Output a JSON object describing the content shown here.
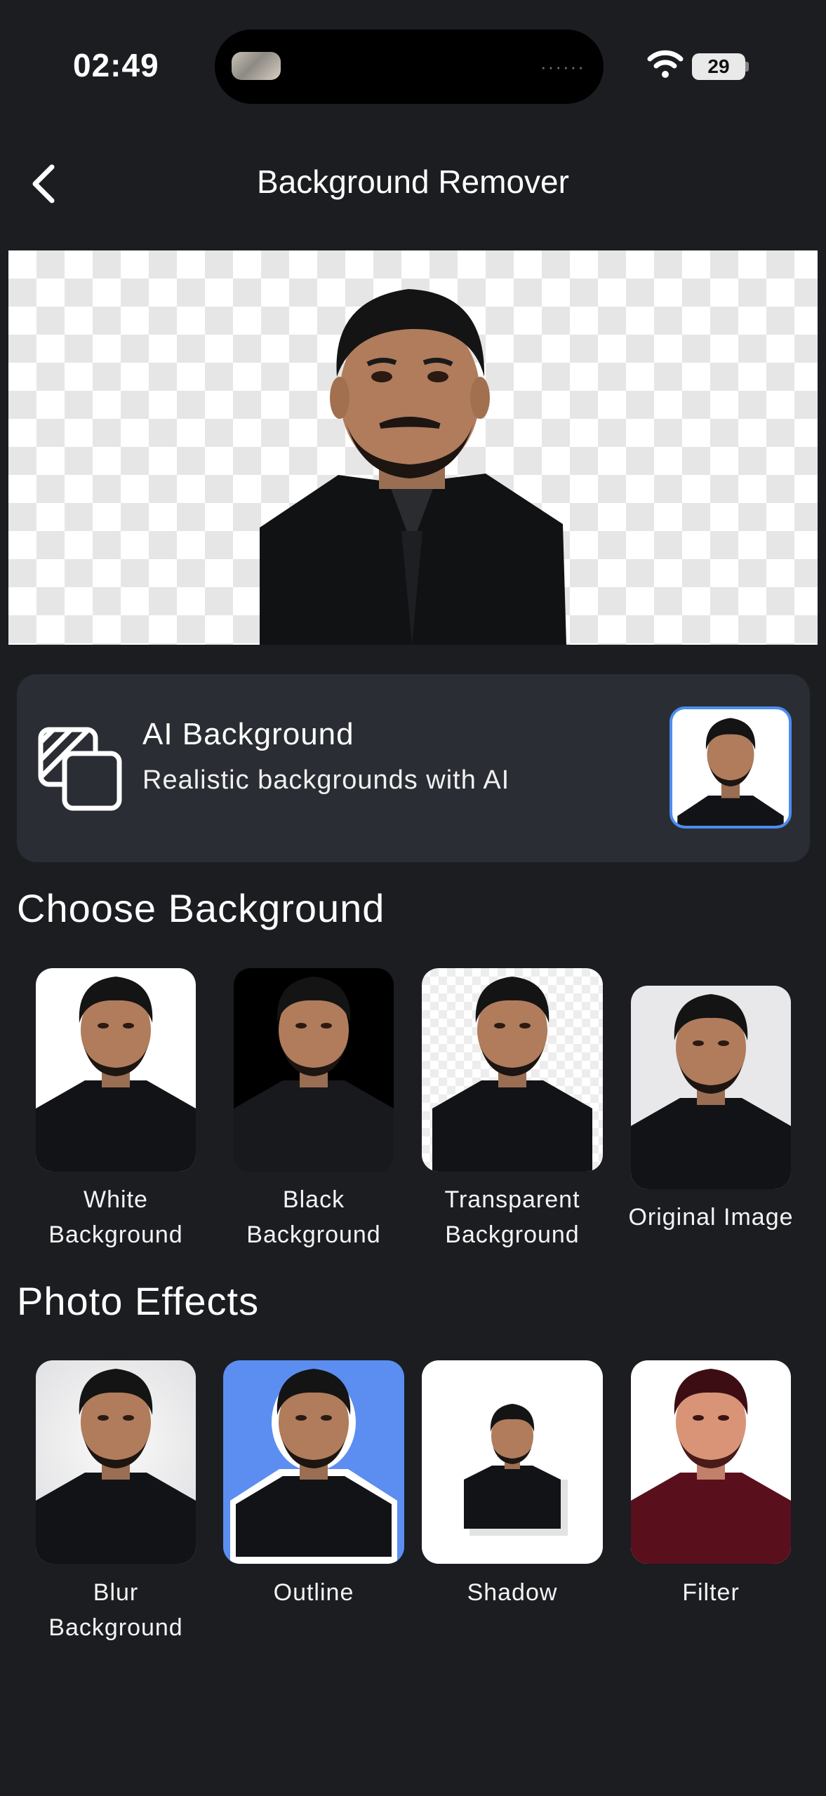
{
  "status_bar": {
    "time": "02:49",
    "battery": "29"
  },
  "header": {
    "title": "Background Remover"
  },
  "ai_card": {
    "title": "AI Background",
    "subtitle": "Realistic backgrounds with AI"
  },
  "choose_background": {
    "heading": "Choose Background",
    "options": [
      {
        "line1": "White",
        "line2": "Background"
      },
      {
        "line1": "Black",
        "line2": "Background"
      },
      {
        "line1": "Transparent",
        "line2": "Background"
      },
      {
        "line1": "Original Image",
        "line2": ""
      }
    ]
  },
  "photo_effects": {
    "heading": "Photo Effects",
    "options": [
      {
        "line1": "Blur",
        "line2": "Background"
      },
      {
        "line1": "Outline",
        "line2": ""
      },
      {
        "line1": "Shadow",
        "line2": ""
      },
      {
        "line1": "Filter",
        "line2": ""
      }
    ]
  },
  "colors": {
    "background": "#1b1d21",
    "card": "#2a2d33",
    "accent": "#4a8df0",
    "outline_bg": "#5b8ef0",
    "filter_tint": "#6a1020"
  }
}
